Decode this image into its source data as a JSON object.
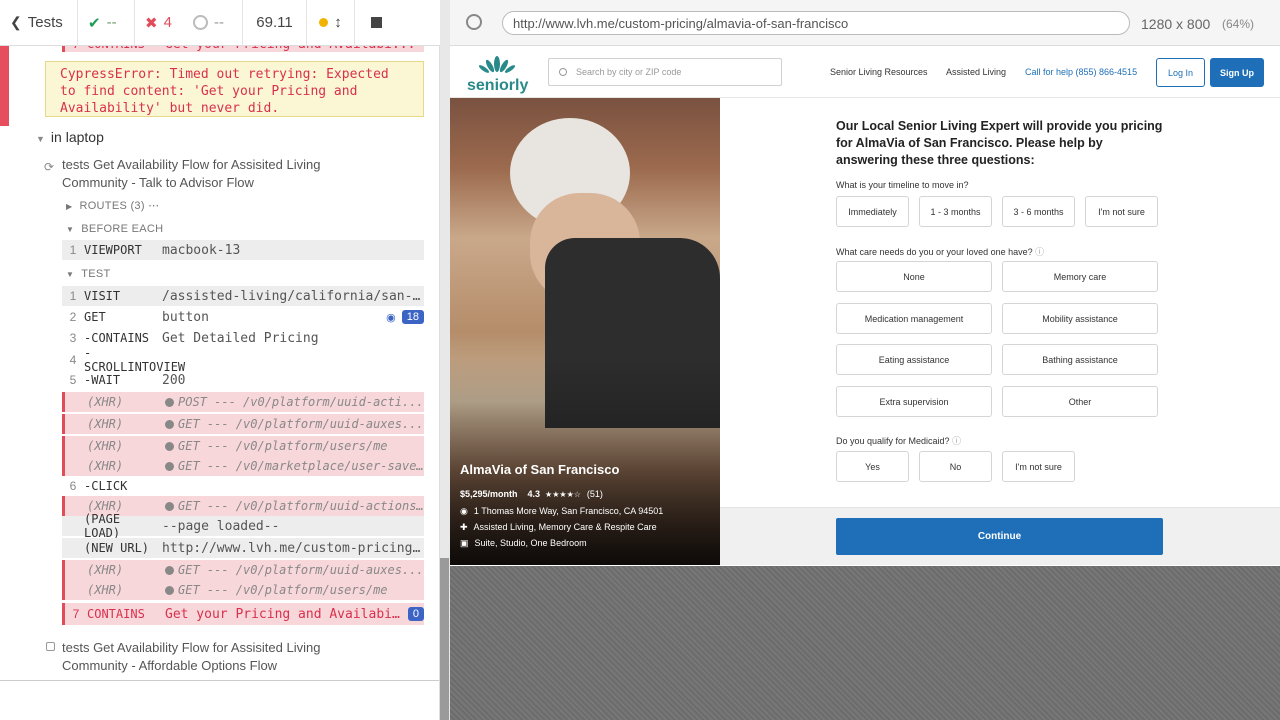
{
  "runner": {
    "tests_label": "Tests",
    "passed": "--",
    "failed": "4",
    "pending": "--",
    "duration": "69.11",
    "error_prev_line": "CONTAINS",
    "error_prev_msg": "Get your Pricing and Availabi...",
    "error_message": "CypressError: Timed out retrying: Expected to find content: 'Get your Pricing and Availability' but never did.",
    "suite_title": "in laptop",
    "test1_title": "tests Get Availability Flow for Assisited Living Community - Talk to Advisor Flow",
    "routes_label": "ROUTES (3)",
    "before_each_label": "BEFORE EACH",
    "test_label": "TEST",
    "before_each_cmd": {
      "num": "1",
      "name": "VIEWPORT",
      "msg": "macbook-13"
    },
    "commands": [
      {
        "num": "1",
        "name": "VISIT",
        "msg": "/assisted-living/california/san-f..."
      },
      {
        "num": "2",
        "name": "GET",
        "msg": "button",
        "badge": "18"
      },
      {
        "num": "3",
        "name": "-CONTAINS",
        "msg": "Get Detailed Pricing"
      },
      {
        "num": "4",
        "name": "-SCROLLINTOVIEW",
        "msg": ""
      },
      {
        "num": "5",
        "name": "-WAIT",
        "msg": "200"
      },
      {
        "num": "",
        "name": "(XHR)",
        "msg": "POST --- /v0/platform/uuid-acti..."
      },
      {
        "num": "",
        "name": "(XHR)",
        "msg": "GET --- /v0/platform/uuid-auxes..."
      },
      {
        "num": "",
        "name": "(XHR)",
        "msg": "GET --- /v0/platform/users/me"
      },
      {
        "num": "",
        "name": "(XHR)",
        "msg": "GET --- /v0/marketplace/user-saves?fi..."
      },
      {
        "num": "6",
        "name": "-CLICK",
        "msg": ""
      },
      {
        "num": "",
        "name": "(XHR)",
        "msg": "GET --- /v0/platform/uuid-actions?fil..."
      },
      {
        "num": "",
        "name": "(PAGE LOAD)",
        "msg": "--page loaded--"
      },
      {
        "num": "",
        "name": "(NEW URL)",
        "msg": "http://www.lvh.me/custom-pricing/..."
      },
      {
        "num": "",
        "name": "(XHR)",
        "msg": "GET --- /v0/platform/uuid-auxes..."
      },
      {
        "num": "",
        "name": "(XHR)",
        "msg": "GET --- /v0/platform/users/me"
      },
      {
        "num": "7",
        "name": "CONTAINS",
        "msg": "Get your Pricing and Availabil...",
        "badge": "0"
      }
    ],
    "test2_title": "tests Get Availability Flow for Assisited Living Community - Affordable Options Flow"
  },
  "browser": {
    "url": "http://www.lvh.me/custom-pricing/almavia-of-san-francisco",
    "viewport": "1280 x 800",
    "scale": "(64%)"
  },
  "site": {
    "logo": "seniorly",
    "search_placeholder": "Search by city or ZIP code",
    "nav": [
      "Senior Living Resources",
      "Assisted Living"
    ],
    "call": "Call for help (855) 866-4515",
    "login": "Log In",
    "signup": "Sign Up",
    "community": {
      "name": "AlmaVia of San Francisco",
      "price": "$5,295/month",
      "rating": "4.3",
      "reviews": "(51)",
      "address": "1 Thomas More Way, San Francisco, CA 94501",
      "care": "Assisted Living, Memory Care & Respite Care",
      "rooms": "Suite, Studio, One Bedroom"
    },
    "heading": "Our Local Senior Living Expert will provide you pricing for AlmaVia of San Francisco. Please help by answering these three questions:",
    "q1": "What is your timeline to move in?",
    "q1_opts": [
      "Immediately",
      "1 - 3 months",
      "3 - 6 months",
      "I'm not sure"
    ],
    "q2": "What care needs do you or your loved one have?",
    "q2_opts": [
      "None",
      "Memory care",
      "Medication management",
      "Mobility assistance",
      "Eating assistance",
      "Bathing assistance",
      "Extra supervision",
      "Other"
    ],
    "q3": "Do you qualify for Medicaid?",
    "q3_opts": [
      "Yes",
      "No",
      "I'm not sure"
    ],
    "continue": "Continue"
  },
  "colors": {
    "brand": "#1e6fb8",
    "error": "#e14b5a",
    "logo": "#2a8a8a"
  }
}
